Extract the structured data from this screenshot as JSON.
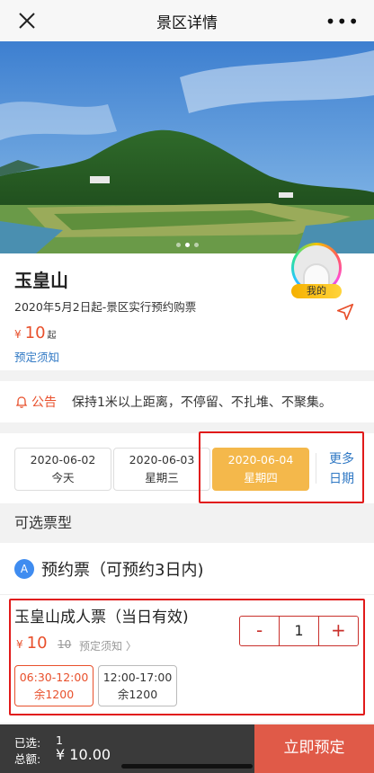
{
  "nav": {
    "title": "景区详情",
    "close_icon": "close-icon",
    "more_icon": "more-icon"
  },
  "banner": {
    "slide_count": 3,
    "active_slide": 1
  },
  "scenic": {
    "name": "玉皇山",
    "notice": "2020年5月2日起-景区实行预约购票",
    "currency": "¥",
    "price": "10",
    "price_suffix": "起",
    "booking_link": "预定须知",
    "mine_badge": "我的"
  },
  "announcement": {
    "tag": "公告",
    "text": "保持1米以上距离，不停留、不扎堆、不聚集。"
  },
  "dates": {
    "items": [
      {
        "date": "2020-06-02",
        "label": "今天",
        "selected": false
      },
      {
        "date": "2020-06-03",
        "label": "星期三",
        "selected": false
      },
      {
        "date": "2020-06-04",
        "label": "星期四",
        "selected": true
      }
    ],
    "more_line1": "更多",
    "more_line2": "日期"
  },
  "tickets": {
    "section_title": "可选票型",
    "group_icon_letter": "A",
    "group_label": "预约票（可预约3日内)",
    "item": {
      "name": "玉皇山成人票（当日有效)",
      "currency": "¥",
      "price": "10",
      "original_price": "10",
      "link": "预定须知 〉",
      "quantity": "1",
      "minus": "-",
      "plus": "+",
      "slots": [
        {
          "time": "06:30-12:00",
          "remain": "余1200",
          "selected": true
        },
        {
          "time": "12:00-17:00",
          "remain": "余1200",
          "selected": false
        }
      ]
    }
  },
  "bottom": {
    "selected_label": "已选:",
    "selected_value": "1",
    "total_label": "总额:",
    "total_value": "¥ 10.00",
    "book_button": "立即预定"
  },
  "colors": {
    "accent": "#e8502c",
    "link": "#2f78c4",
    "selected_date": "#f4b84b",
    "book_button": "#e05a48",
    "highlight_box": "#e11a1a"
  }
}
